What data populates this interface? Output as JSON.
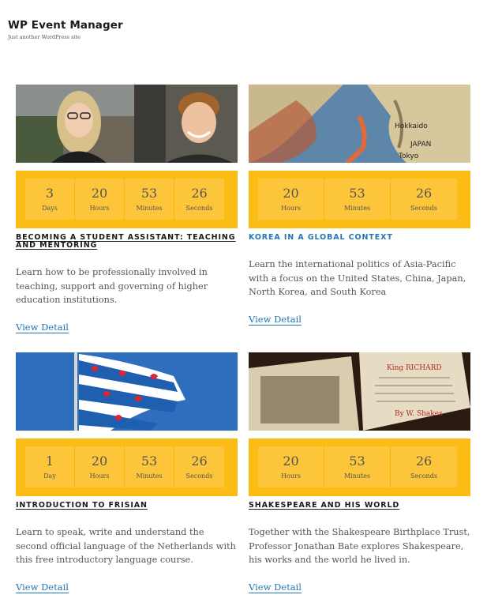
{
  "site": {
    "title": "WP Event Manager",
    "tagline": "Just another WordPress site"
  },
  "events": [
    {
      "image": "two-people-smiling-photo",
      "countdown": [
        {
          "value": "3",
          "label": "Days"
        },
        {
          "value": "20",
          "label": "Hours"
        },
        {
          "value": "53",
          "label": "Minutes"
        },
        {
          "value": "26",
          "label": "Seconds"
        }
      ],
      "title": "Becoming a Student Assistant: Teaching and Mentoring",
      "description": "Learn how to be professionally involved in teaching, support and governing of higher education institutions.",
      "link": "View Detail"
    },
    {
      "image": "globe-map-japan-photo",
      "countdown": [
        {
          "value": "20",
          "label": "Hours"
        },
        {
          "value": "53",
          "label": "Minutes"
        },
        {
          "value": "26",
          "label": "Seconds"
        }
      ],
      "title": "Korea in a Global Context",
      "description": "Learn the international politics of Asia-Pacific with a focus on the United States, China, Japan, North Korea, and South Korea",
      "link": "View Detail"
    },
    {
      "image": "frisian-flag-photo",
      "countdown": [
        {
          "value": "1",
          "label": "Day"
        },
        {
          "value": "20",
          "label": "Hours"
        },
        {
          "value": "53",
          "label": "Minutes"
        },
        {
          "value": "26",
          "label": "Seconds"
        }
      ],
      "title": "Introduction to Frisian",
      "description": "Learn to speak, write and understand the second official language of the Netherlands with this free introductory language course.",
      "link": "View Detail"
    },
    {
      "image": "old-book-photo",
      "countdown": [
        {
          "value": "20",
          "label": "Hours"
        },
        {
          "value": "53",
          "label": "Minutes"
        },
        {
          "value": "26",
          "label": "Seconds"
        }
      ],
      "title": "Shakespeare and His World",
      "description": "Together with the Shakespeare Birthplace Trust, Professor Jonathan Bate explores Shakespeare, his works and the world he lived in.",
      "link": "View Detail"
    }
  ],
  "colors": {
    "countdown_bg": "#fbbd15",
    "countdown_cell": "#fcc53a",
    "link": "#2477b3"
  }
}
